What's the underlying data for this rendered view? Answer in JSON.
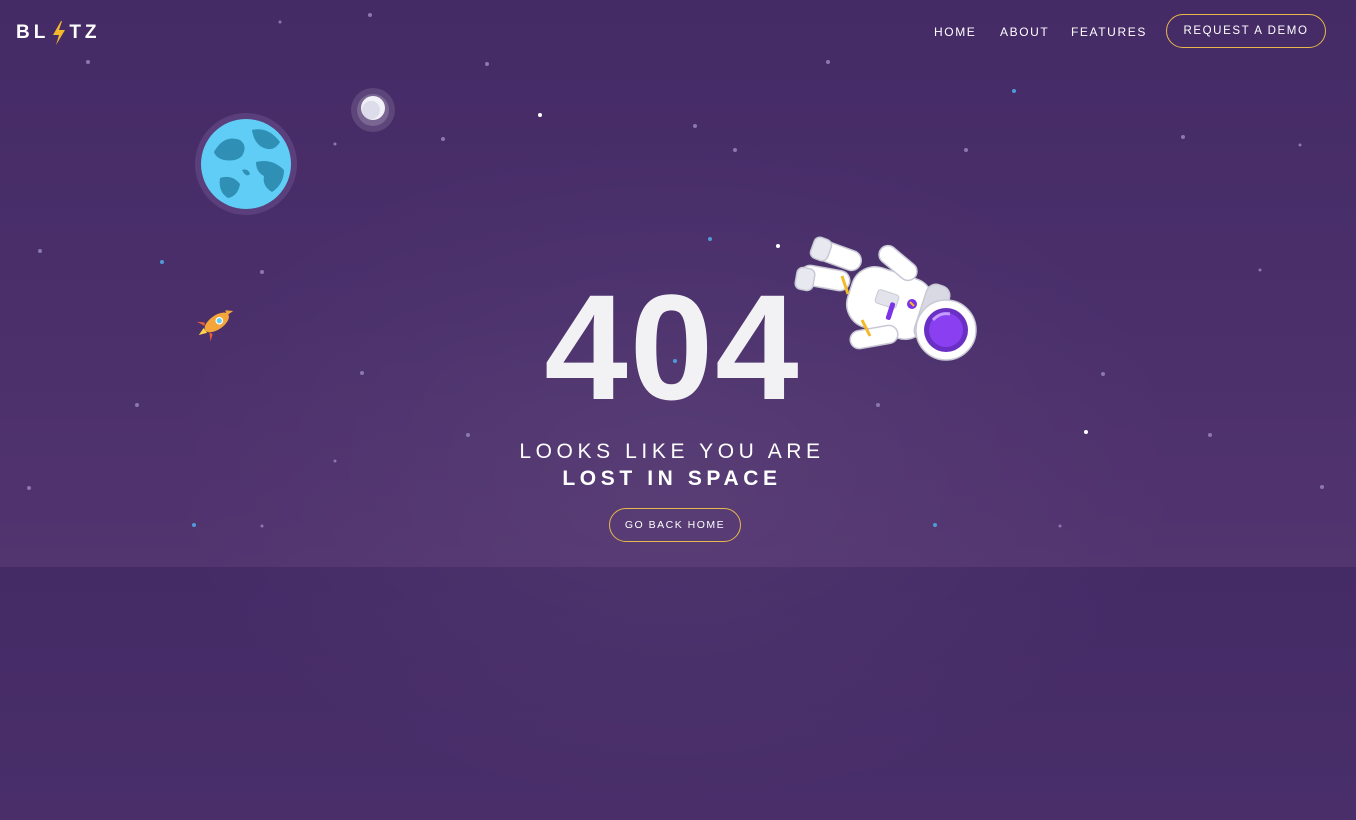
{
  "brand": {
    "name_left": "BL",
    "name_right": "TZ",
    "icon": "lightning-bolt-icon"
  },
  "nav": {
    "items": [
      {
        "label": "HOME"
      },
      {
        "label": "ABOUT"
      },
      {
        "label": "FEATURES"
      }
    ],
    "cta_label": "REQUEST A DEMO"
  },
  "error": {
    "code": "404",
    "line1": "LOOKS LIKE YOU ARE",
    "line2": "LOST IN SPACE",
    "button_label": "GO BACK HOME"
  },
  "colors": {
    "background": "#4a2f6b",
    "accent": "#e7b84b",
    "planet": "#5fcdf5"
  },
  "decorations": [
    "planet-earth-icon",
    "moon-icon",
    "rocket-icon",
    "astronaut-illustration"
  ]
}
